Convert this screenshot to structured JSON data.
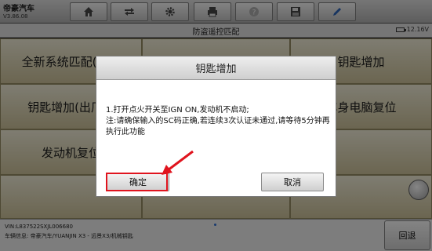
{
  "app": {
    "brand": "帝豪汽车",
    "version": "V3.86.08"
  },
  "toolbar": {
    "buttons": [
      {
        "name": "home-button",
        "icon": "home-icon"
      },
      {
        "name": "transfer-button",
        "icon": "car-arrows-icon"
      },
      {
        "name": "settings-button",
        "icon": "gear-icon"
      },
      {
        "name": "print-button",
        "icon": "printer-icon"
      },
      {
        "name": "help-button",
        "icon": "question-icon"
      },
      {
        "name": "save-button",
        "icon": "floppy-disk-icon"
      },
      {
        "name": "edit-button",
        "icon": "pen-icon"
      }
    ]
  },
  "subheader": {
    "title": "防盗遥控匹配",
    "battery": "12.16V"
  },
  "menu": {
    "items": [
      "全新系统匹配(出厂",
      "钥匙增加",
      "钥匙增加(出厂模",
      "车身电脑复位",
      "发动机复位"
    ]
  },
  "footer": {
    "vin": "VIN:L837522SXJL006680",
    "car": "车辆信息: 帝豪汽车/YUANJIN X3 - 远景X3/机械钥匙",
    "back_label": "回退"
  },
  "dialog": {
    "title": "钥匙增加",
    "line1": "1.打开点火开关至IGN ON,发动机不启动;",
    "line2": "注:请确保输入的SC码正确,若连续3次认证未通过,请等待5分钟再执行此功能",
    "ok_label": "确定",
    "cancel_label": "取消"
  },
  "colors": {
    "highlight": "#e0141e",
    "menu_bg": "#c9c0a0"
  }
}
